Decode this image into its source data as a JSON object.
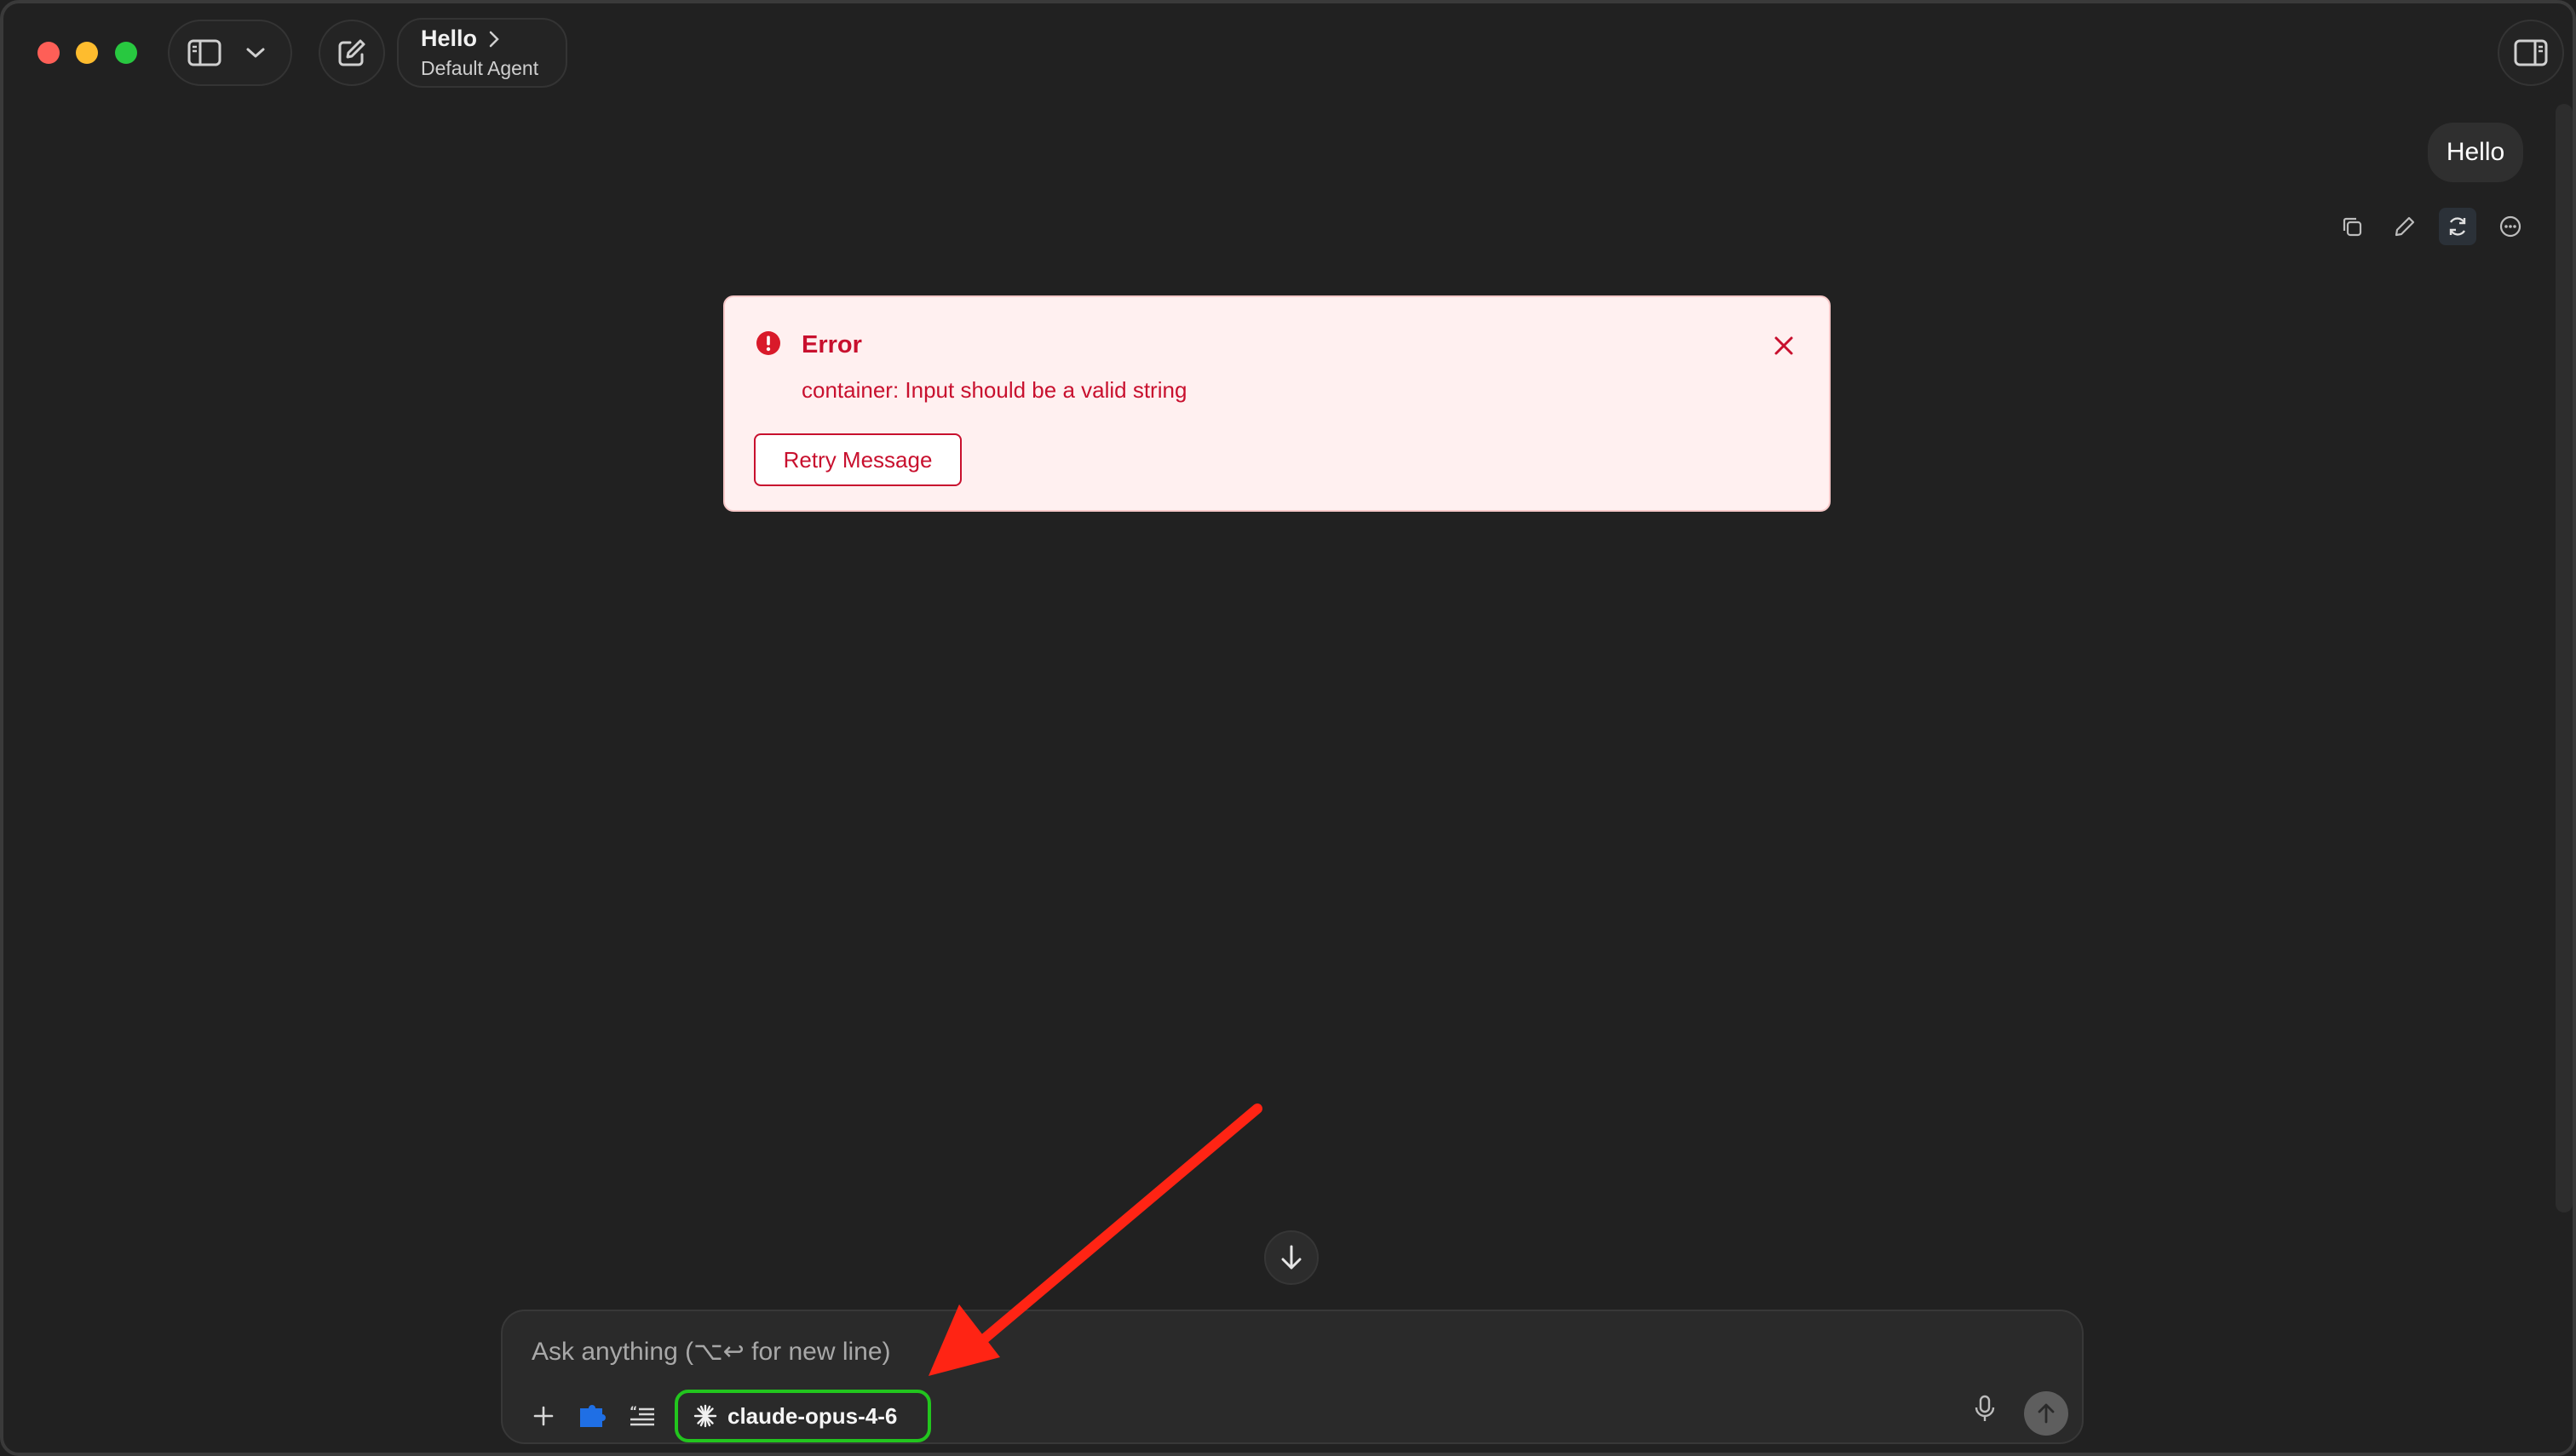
{
  "header": {
    "title": "Hello",
    "subtitle": "Default Agent"
  },
  "conversation": {
    "user_message": "Hello"
  },
  "error": {
    "title": "Error",
    "message": "container: Input should be a valid string",
    "retry_label": "Retry Message"
  },
  "composer": {
    "placeholder": "Ask anything (⌥↩ for new line)",
    "model": "claude-opus-4-6"
  },
  "icons": {
    "sidebar": "sidebar-toggle-icon",
    "chevron": "chevron-down-icon",
    "new_chat": "compose-icon",
    "right_panel": "right-panel-icon",
    "copy": "copy-icon",
    "edit": "pencil-icon",
    "regenerate": "refresh-icon",
    "more": "more-icon",
    "error": "alert-circle-icon",
    "close": "close-icon",
    "scroll_down": "arrow-down-icon",
    "add": "plus-icon",
    "plugin": "puzzle-icon",
    "prompts": "quote-list-icon",
    "model": "sparkle-icon",
    "mic": "mic-icon",
    "send": "arrow-up-icon"
  },
  "colors": {
    "background": "#212121",
    "error_text": "#c8102e",
    "error_bg": "#fff0f0",
    "model_highlight": "#22c51e",
    "annotation_arrow": "#ff2414"
  }
}
